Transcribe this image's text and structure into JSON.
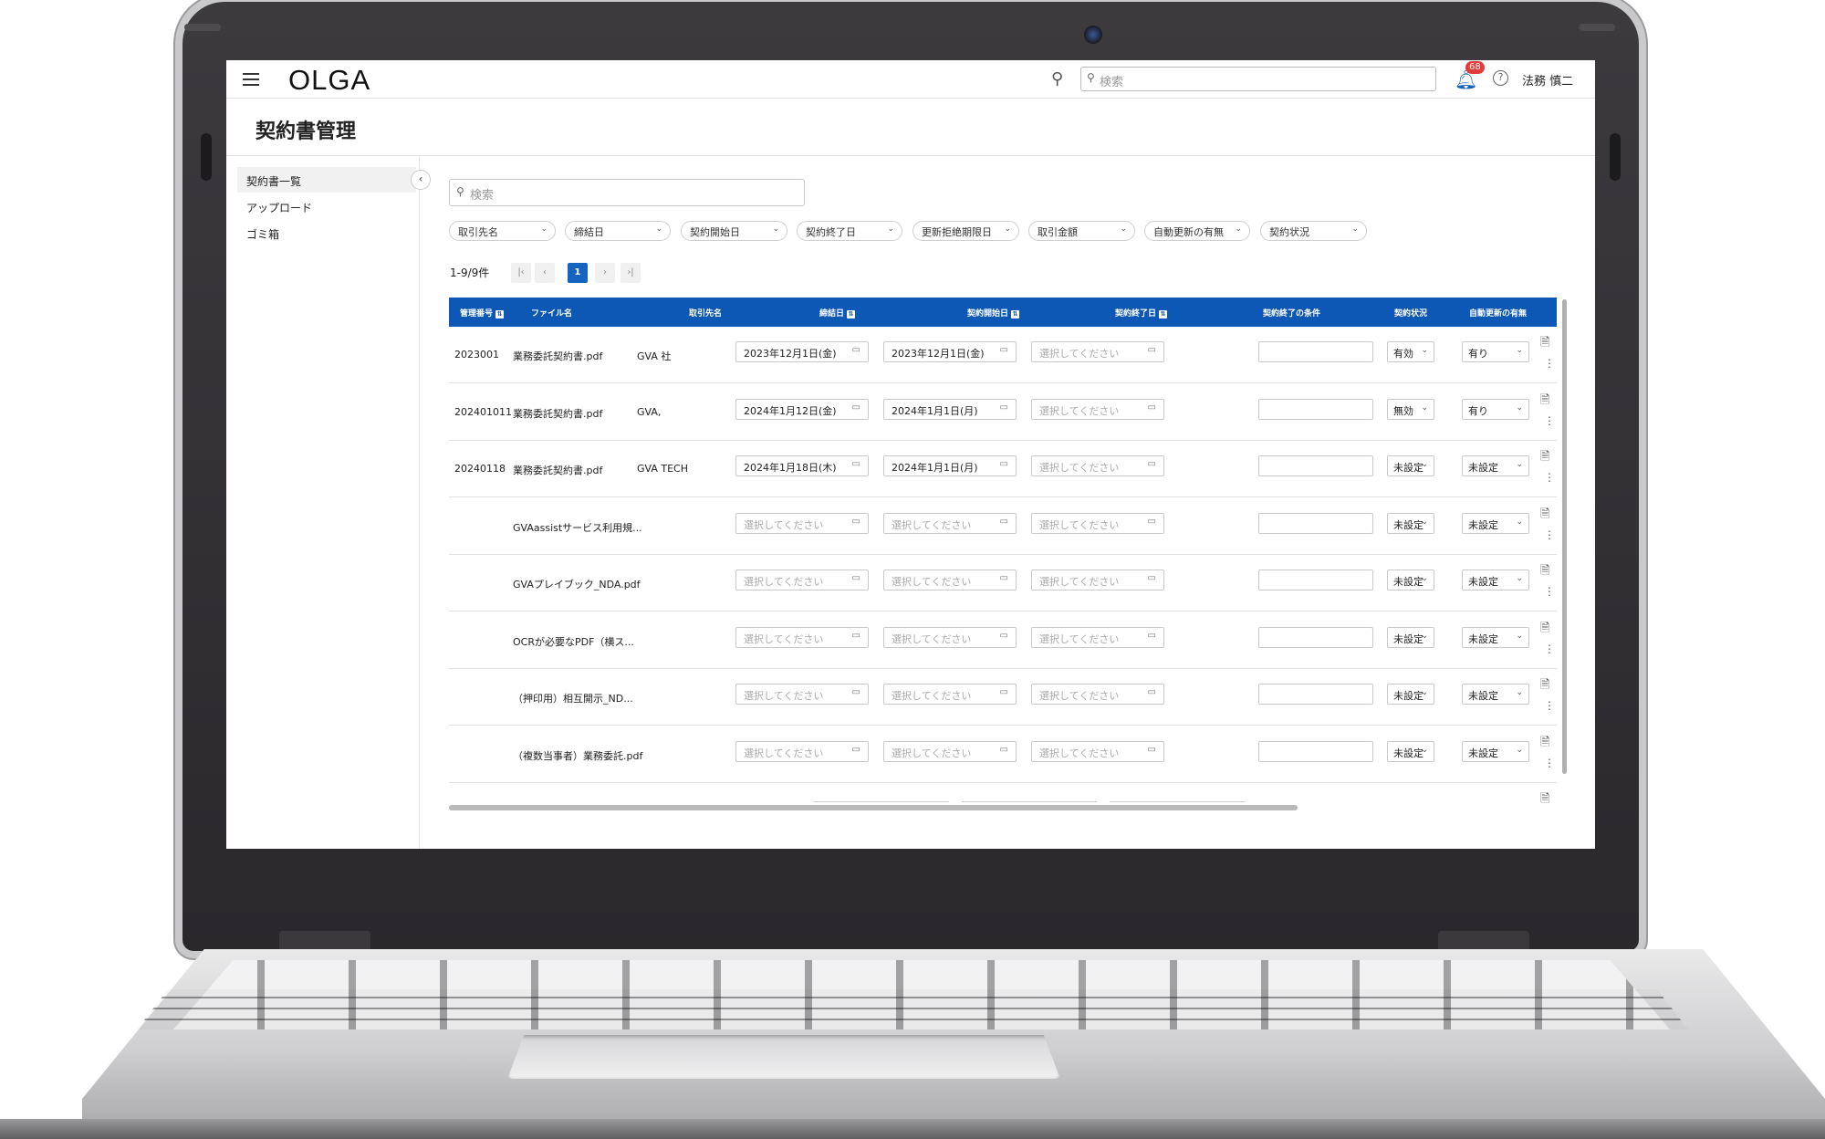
{
  "app": {
    "logo": "OLGA"
  },
  "header": {
    "search_placeholder": "検索",
    "notification_count": "68",
    "user_name": "法務 慎二"
  },
  "page": {
    "title": "契約書管理"
  },
  "sidebar": {
    "items": [
      {
        "label": "契約書一覧",
        "active": true
      },
      {
        "label": "アップロード",
        "active": false
      },
      {
        "label": "ゴミ箱",
        "active": false
      }
    ]
  },
  "filters": {
    "search_placeholder": "検索",
    "chips": [
      "取引先名",
      "締結日",
      "契約開始日",
      "契約終了日",
      "更新拒絶期限日",
      "取引金額",
      "自動更新の有無",
      "契約状況"
    ]
  },
  "pagination": {
    "count_label": "1-9/9件",
    "current_page": "1"
  },
  "table": {
    "columns": [
      "管理番号",
      "ファイル名",
      "取引先名",
      "締結日",
      "契約開始日",
      "契約終了日",
      "契約終了の条件",
      "契約状況",
      "自動更新の有無"
    ],
    "date_placeholder": "選択してください",
    "rows": [
      {
        "id": "2023001",
        "file": "業務委託契約書.pdf",
        "partner": "GVA 社",
        "signed": "2023年12月1日(金)",
        "start": "2023年12月1日(金)",
        "end": "",
        "status": "有効",
        "auto": "有り"
      },
      {
        "id": "202401011",
        "file": "業務委託契約書.pdf",
        "partner": "GVA,",
        "signed": "2024年1月12日(金)",
        "start": "2024年1月1日(月)",
        "end": "",
        "status": "無効",
        "auto": "有り"
      },
      {
        "id": "20240118",
        "file": "業務委託契約書.pdf",
        "partner": "GVA TECH",
        "signed": "2024年1月18日(木)",
        "start": "2024年1月1日(月)",
        "end": "",
        "status": "未設定",
        "auto": "未設定"
      },
      {
        "id": "",
        "file": "GVAassistサービス利用規...",
        "partner": "",
        "signed": "",
        "start": "",
        "end": "",
        "status": "未設定",
        "auto": "未設定"
      },
      {
        "id": "",
        "file": "GVAプレイブック_NDA.pdf",
        "partner": "",
        "signed": "",
        "start": "",
        "end": "",
        "status": "未設定",
        "auto": "未設定"
      },
      {
        "id": "",
        "file": "OCRが必要なPDF（横ス...",
        "partner": "",
        "signed": "",
        "start": "",
        "end": "",
        "status": "未設定",
        "auto": "未設定"
      },
      {
        "id": "",
        "file": "（押印用）相互開示_ND...",
        "partner": "",
        "signed": "",
        "start": "",
        "end": "",
        "status": "未設定",
        "auto": "未設定"
      },
      {
        "id": "",
        "file": "（複数当事者）業務委託.pdf",
        "partner": "",
        "signed": "",
        "start": "",
        "end": "",
        "status": "未設定",
        "auto": "未設定"
      }
    ]
  },
  "colors": {
    "accent": "#0d57b5",
    "badge": "#e23b3b"
  }
}
